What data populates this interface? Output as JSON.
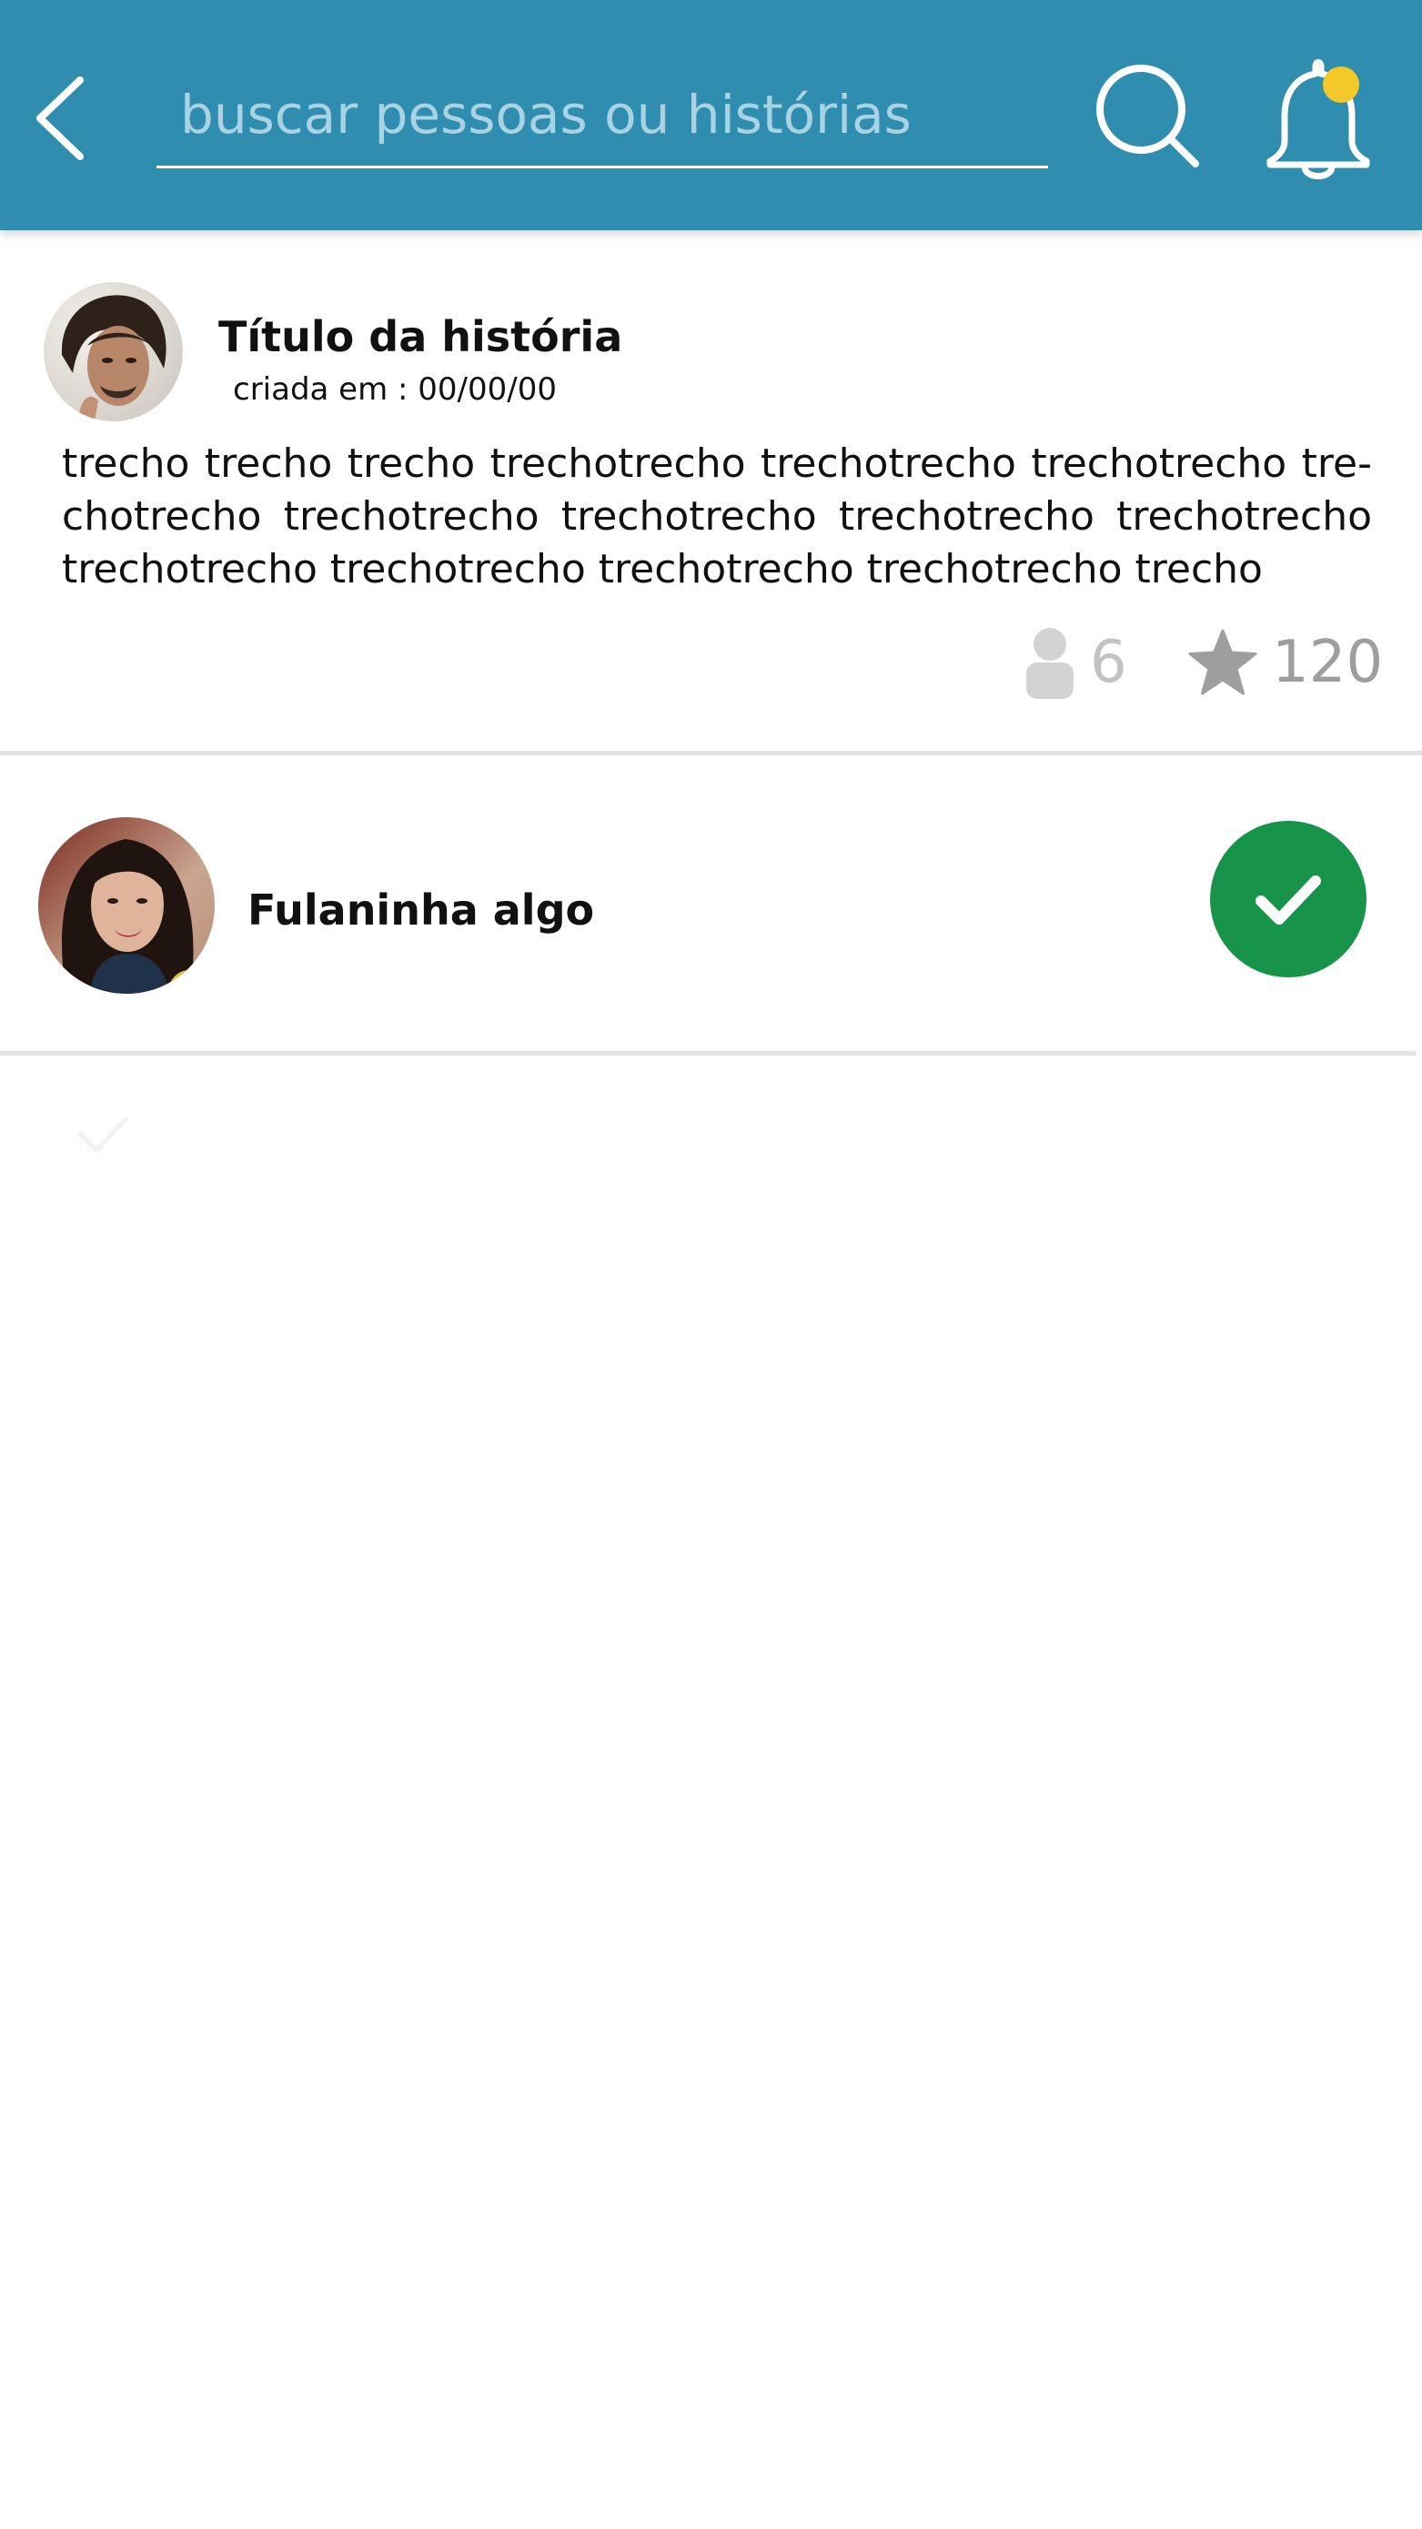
{
  "header": {
    "search_placeholder": "buscar pessoas ou histórias",
    "search_value": "",
    "colors": {
      "bar": "#2f8daf",
      "notification_dot": "#f2c928"
    },
    "icons": {
      "back": "chevron-left-icon",
      "search": "search-icon",
      "notifications": "bell-icon"
    }
  },
  "story": {
    "title": "Título da história",
    "created_at": "criada em : 00/00/00",
    "excerpt": "trecho trecho trecho trechotrecho trechotrecho trechotrecho tre­chotrecho trechotrecho trechotrecho trechotrecho trechotrecho trechotrecho trechotrecho trechotrecho trechotrecho trecho",
    "participants_count": "6",
    "stars_count": "120",
    "icons": {
      "participants": "person-icon",
      "stars": "star-icon"
    }
  },
  "user": {
    "name": "Fulaninha algo",
    "status": "selected",
    "colors": {
      "check_button": "#17934a"
    },
    "icons": {
      "status": "check-icon"
    }
  }
}
